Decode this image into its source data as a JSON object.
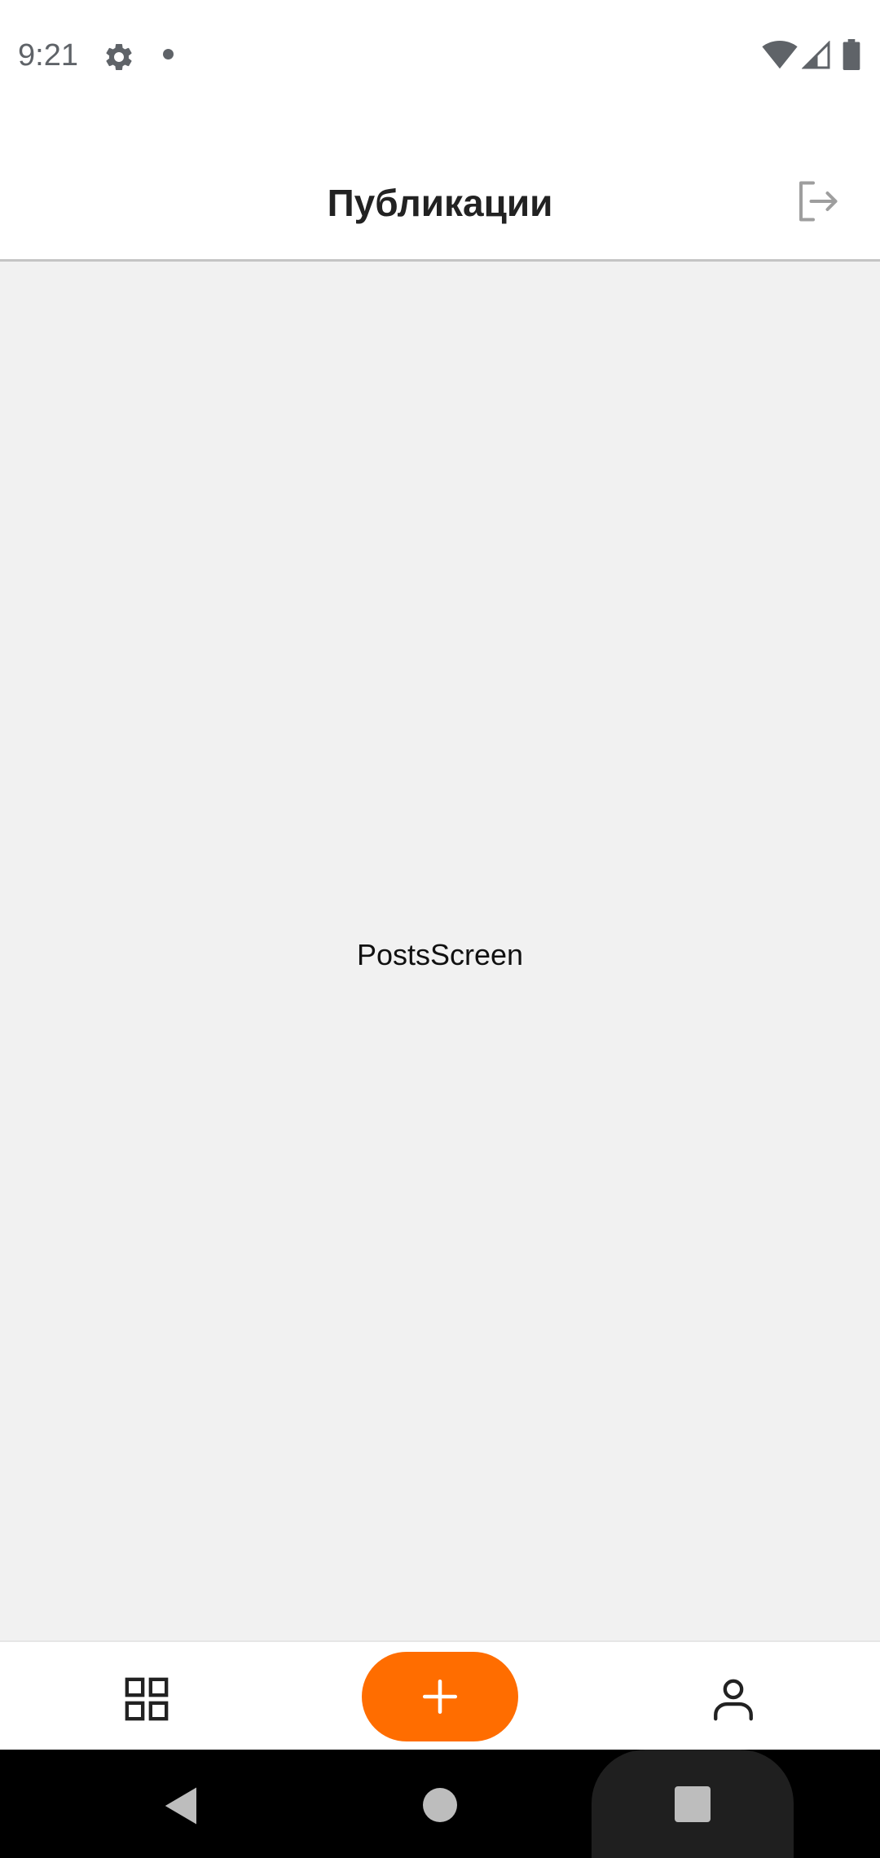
{
  "status_bar": {
    "time": "9:21",
    "icons": [
      "gear-icon",
      "notification-dot-icon",
      "wifi-icon",
      "signal-icon",
      "battery-icon"
    ]
  },
  "app_bar": {
    "title": "Публикации",
    "logout_icon": "logout-icon"
  },
  "content": {
    "label": "PostsScreen"
  },
  "bottom_nav": {
    "items": [
      {
        "icon": "grid-icon"
      },
      {
        "icon": "plus-icon"
      },
      {
        "icon": "user-icon"
      }
    ],
    "accent_color": "#ff6d00"
  },
  "system_nav": {
    "buttons": [
      "back",
      "home",
      "recents"
    ]
  },
  "colors": {
    "content_bg": "#f1f1f1",
    "accent": "#ff6d00",
    "icon_gray": "#9e9e9e"
  }
}
